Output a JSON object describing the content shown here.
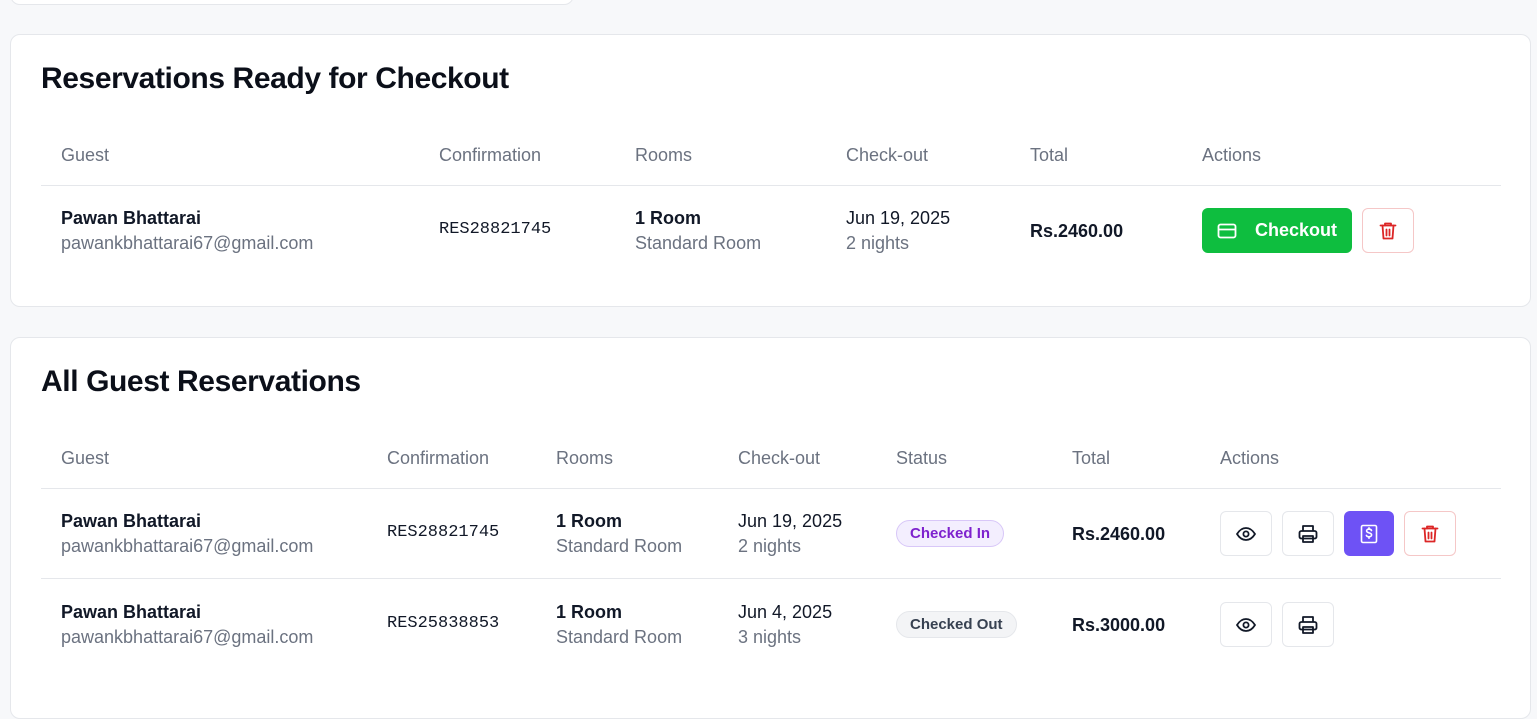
{
  "checkout_section": {
    "title": "Reservations Ready for Checkout",
    "headers": {
      "guest": "Guest",
      "confirmation": "Confirmation",
      "rooms": "Rooms",
      "checkout": "Check-out",
      "total": "Total",
      "actions": "Actions"
    },
    "rows": [
      {
        "guest_name": "Pawan Bhattarai",
        "guest_email": "pawankbhattarai67@gmail.com",
        "confirmation": "RES28821745",
        "rooms": "1 Room",
        "room_type": "Standard Room",
        "checkout_date": "Jun 19, 2025",
        "nights": "2 nights",
        "total": "Rs.2460.00",
        "checkout_label": "Checkout"
      }
    ]
  },
  "all_section": {
    "title": "All Guest Reservations",
    "headers": {
      "guest": "Guest",
      "confirmation": "Confirmation",
      "rooms": "Rooms",
      "checkout": "Check-out",
      "status": "Status",
      "total": "Total",
      "actions": "Actions"
    },
    "rows": [
      {
        "guest_name": "Pawan Bhattarai",
        "guest_email": "pawankbhattarai67@gmail.com",
        "confirmation": "RES28821745",
        "rooms": "1 Room",
        "room_type": "Standard Room",
        "checkout_date": "Jun 19, 2025",
        "nights": "2 nights",
        "status": "Checked In",
        "total": "Rs.2460.00"
      },
      {
        "guest_name": "Pawan Bhattarai",
        "guest_email": "pawankbhattarai67@gmail.com",
        "confirmation": "RES25838853",
        "rooms": "1 Room",
        "room_type": "Standard Room",
        "checkout_date": "Jun 4, 2025",
        "nights": "3 nights",
        "status": "Checked Out",
        "total": "Rs.3000.00"
      }
    ]
  },
  "colors": {
    "checkout_green": "#0ebe3f",
    "invoice_purple": "#6e52f5",
    "delete_red": "#dc2626",
    "checked_in_purple": "#7e22ce",
    "checked_out_gray": "#374151"
  },
  "icons": {
    "checkout": "credit-card-icon",
    "delete": "trash-icon",
    "view": "eye-icon",
    "print": "printer-icon",
    "invoice": "receipt-dollar-icon"
  }
}
